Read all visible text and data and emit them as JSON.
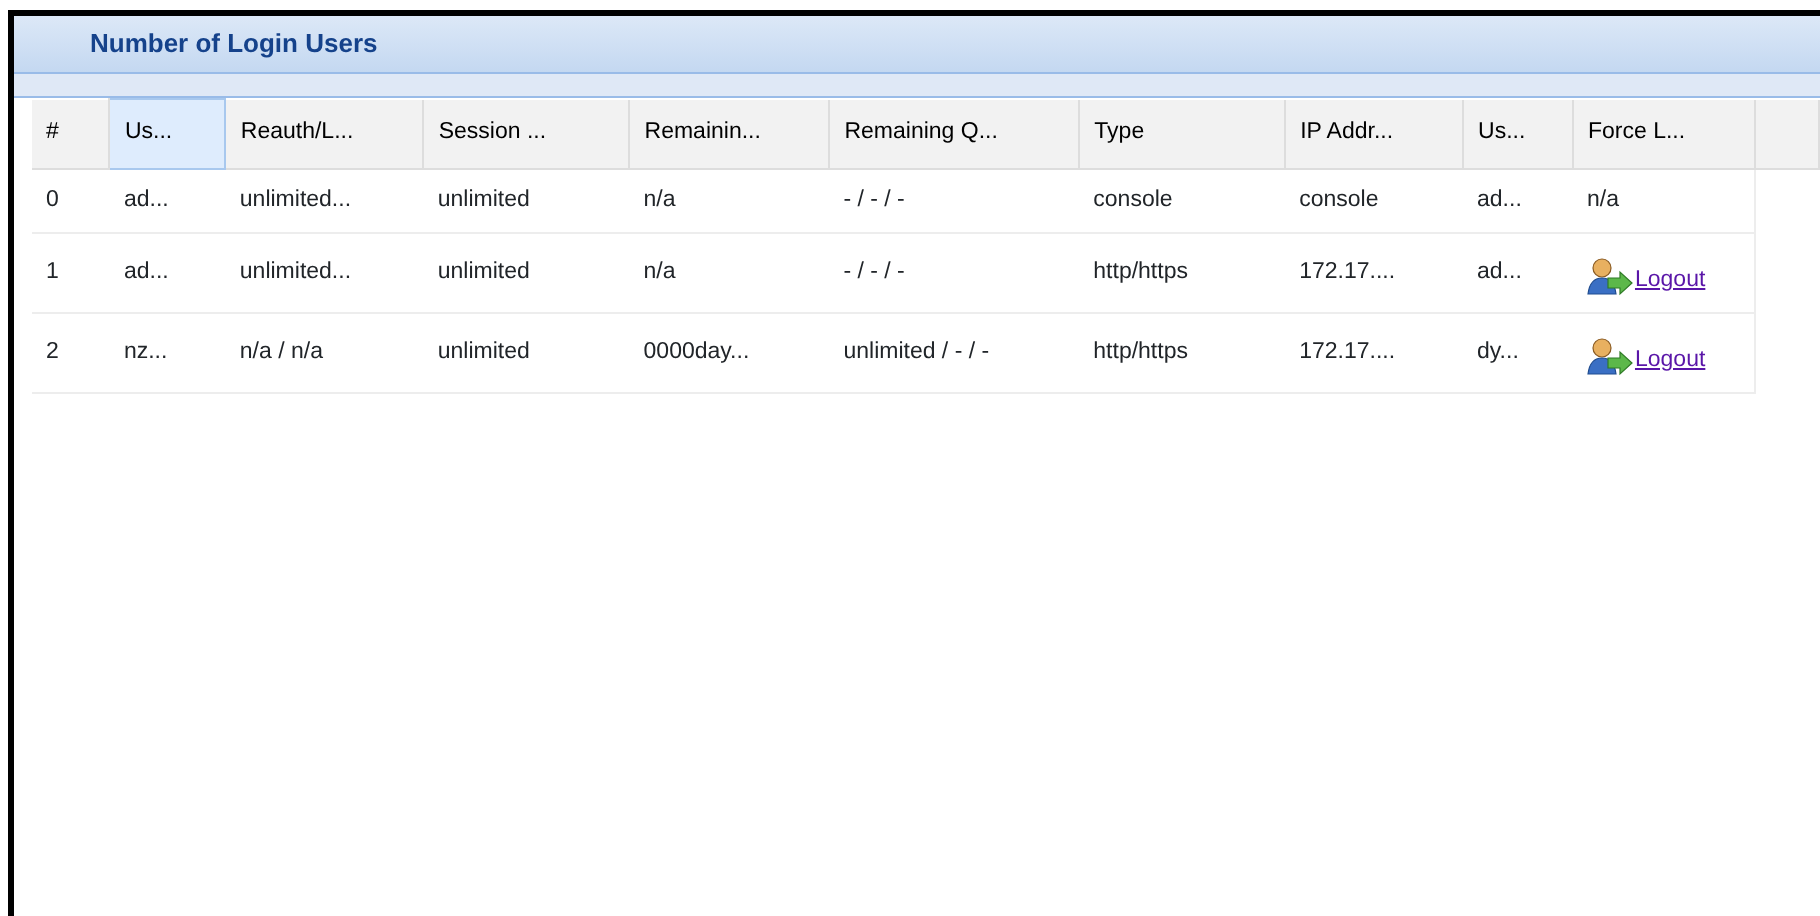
{
  "panel": {
    "title": "Number of Login Users"
  },
  "table": {
    "columns": [
      {
        "label": "#",
        "selected": false
      },
      {
        "label": "Us...",
        "selected": true
      },
      {
        "label": "Reauth/L...",
        "selected": false
      },
      {
        "label": "Session ...",
        "selected": false
      },
      {
        "label": "Remainin...",
        "selected": false
      },
      {
        "label": "Remaining Q...",
        "selected": false
      },
      {
        "label": "Type",
        "selected": false
      },
      {
        "label": "IP Addr...",
        "selected": false
      },
      {
        "label": "Us...",
        "selected": false
      },
      {
        "label": "Force L...",
        "selected": false
      }
    ],
    "rows": [
      {
        "cells": [
          "0",
          "ad...",
          "unlimited...",
          "unlimited",
          "n/a",
          "- / - / -",
          "console",
          "console",
          "ad..."
        ],
        "force_logout": {
          "kind": "text",
          "text": "n/a"
        }
      },
      {
        "cells": [
          "1",
          "ad...",
          "unlimited...",
          "unlimited",
          "n/a",
          "- / - / -",
          "http/https",
          "172.17....",
          "ad..."
        ],
        "force_logout": {
          "kind": "link",
          "text": "Logout"
        }
      },
      {
        "cells": [
          "2",
          "nz...",
          "n/a / n/a",
          "unlimited",
          "0000day...",
          "unlimited / - / -",
          "http/https",
          "172.17....",
          "dy..."
        ],
        "force_logout": {
          "kind": "link",
          "text": "Logout"
        }
      }
    ]
  }
}
